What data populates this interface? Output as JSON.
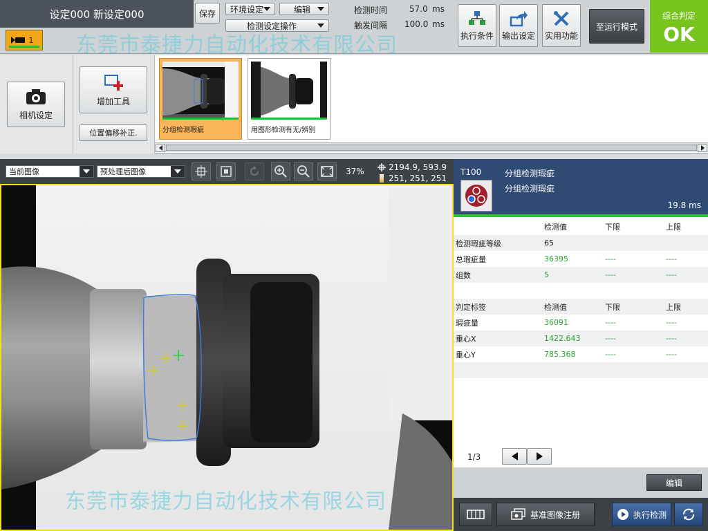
{
  "header": {
    "setting_title": "设定000 新设定000",
    "slot_number": "1",
    "save_label": "保存",
    "env_setting_label": "环境设定",
    "edit_menu_label": "编辑",
    "detect_setting_label": "检测设定操作",
    "detect_time_label": "检测时间",
    "detect_time_value": "57.0",
    "detect_time_unit": "ms",
    "trigger_interval_label": "触发间隔",
    "trigger_interval_value": "100.0",
    "trigger_interval_unit": "ms",
    "exec_condition_label": "执行条件",
    "output_setting_label": "输出设定",
    "utility_label": "实用功能",
    "run_mode_label": "至运行模式",
    "judge_label": "综合判定",
    "judge_value": "OK"
  },
  "toolstrip": {
    "camera_setting_label": "相机设定",
    "add_tool_label": "增加工具",
    "position_correction_label": "位置偏移补正.",
    "tools": [
      {
        "label": "分组检测瑕疵",
        "selected": true
      },
      {
        "label": "用图形检测有无/辨别",
        "selected": false
      }
    ]
  },
  "image_toolbar": {
    "source_select": "当前图像",
    "process_select": "预处理后图像",
    "zoom_percent": "37%",
    "cursor_coord": "2194.9, 593.9",
    "pixel_value": "251, 251, 251"
  },
  "result_panel": {
    "tool_id": "T100",
    "tool_name": "分组检测瑕疵",
    "tool_subname": "分组检测瑕疵",
    "elapsed": "19.8 ms",
    "table1_headers": [
      "",
      "检测值",
      "下限",
      "上限"
    ],
    "table1_rows": [
      [
        "检测瑕疵等级",
        "65",
        "",
        ""
      ],
      [
        "总瑕疵量",
        "36395",
        "----",
        "----"
      ],
      [
        "组数",
        "5",
        "----",
        "----"
      ]
    ],
    "table2_headers": [
      "判定标签",
      "检测值",
      "下限",
      "上限"
    ],
    "table2_rows": [
      [
        "瑕疵量",
        "36091",
        "----",
        "----"
      ],
      [
        "重心X",
        "1422.643",
        "----",
        "----"
      ],
      [
        "重心Y",
        "785.368",
        "----",
        "----"
      ]
    ],
    "page_indicator": "1/3",
    "edit_label": "编辑",
    "ref_image_label": "基准图像注册",
    "exec_detect_label": "执行检测"
  },
  "watermark": "东莞市泰捷力自动化技术有限公司",
  "colors": {
    "accent_ok": "#78c41f",
    "selected_tool": "#f8b55a",
    "panel_header": "#2f4a73",
    "value_green": "#2aa032",
    "frame_yellow": "#f0e020"
  }
}
